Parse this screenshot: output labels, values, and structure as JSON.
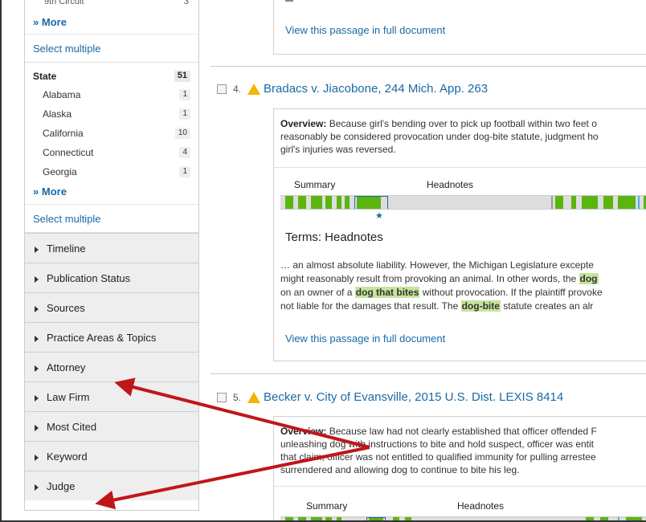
{
  "sidebar": {
    "cut_top_label": "9th Circuit",
    "cut_top_count": "3",
    "more_label_1": "More",
    "select_multiple_1": "Select multiple",
    "state_header": "State",
    "state_count": "51",
    "states": [
      {
        "name": "Alabama",
        "count": "1"
      },
      {
        "name": "Alaska",
        "count": "1"
      },
      {
        "name": "California",
        "count": "10"
      },
      {
        "name": "Connecticut",
        "count": "4"
      },
      {
        "name": "Georgia",
        "count": "1"
      }
    ],
    "more_label_2": "More",
    "select_multiple_2": "Select multiple",
    "facets": [
      "Timeline",
      "Publication Status",
      "Sources",
      "Practice Areas & Topics",
      "Attorney",
      "Law Firm",
      "Most Cited",
      "Keyword",
      "Judge"
    ]
  },
  "main": {
    "top_view_link": "View this passage in full document",
    "results": [
      {
        "number": "4.",
        "title": "Bradacs v. Jiacobone, 244 Mich. App. 263",
        "overview_label": "Overview:",
        "overview_lines": [
          "Because girl's bending over to pick up football within two feet o",
          "reasonably be considered provocation under dog-bite statute, judgment ho",
          "girl's injuries was reversed."
        ],
        "tab_summary": "Summary",
        "tab_headnotes": "Headnotes",
        "terms_heading": "Terms: Headnotes",
        "snippet": {
          "l1": "… an almost absolute liability. However, the Michigan Legislature excepte",
          "l2_pre": "might reasonably result from provoking an animal. In other words, the ",
          "l2_hl": "dog",
          "l3_pre": "on an owner of a ",
          "l3_hl": "dog that bites",
          "l3_post": " without provocation. If the plaintiff provoke",
          "l4_pre": "not liable for the damages that result. The ",
          "l4_hl": "dog-bite",
          "l4_post": " statute creates an alr"
        },
        "view_link": "View this passage in full document"
      },
      {
        "number": "5.",
        "title": "Becker v. City of Evansville, 2015 U.S. Dist. LEXIS 8414",
        "overview_label": "Overview:",
        "overview_lines": [
          "Because law had not clearly established that officer offended F",
          "unleashing dog with instructions to bite and hold suspect, officer was entit",
          "that claim; officer was not entitled to qualified immunity for pulling arrestee",
          "surrendered and allowing dog to continue to bite his leg."
        ],
        "tab_summary": "Summary",
        "tab_headnotes": "Headnotes"
      }
    ]
  },
  "colors": {
    "link": "#1a6aa5",
    "bar_green": "#5ab510",
    "highlight": "#c5e59a",
    "warning": "#f2b600",
    "arrow": "#c0161b"
  }
}
